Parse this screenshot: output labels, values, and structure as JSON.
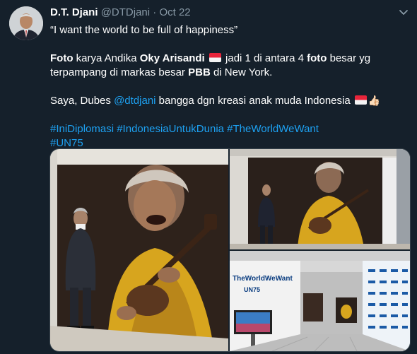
{
  "tweet": {
    "name": "D.T. Djani",
    "handle": "@DTDjani",
    "separator": "·",
    "date": "Oct 22",
    "line1": "“I want the world to be full of happiness”",
    "p2": {
      "foto1": "Foto",
      "t1": " karya Andika ",
      "oky": "Oky Arisandi",
      "t2": " jadi 1 di antara 4 ",
      "foto2": "foto",
      "t3": " besar yg terpampang di markas besar ",
      "pbb": "PBB",
      "t4": " di New York."
    },
    "p3": {
      "t1": "Saya, Dubes ",
      "mention": "@dtdjani",
      "t2": " bangga dgn kreasi anak muda Indonesia"
    },
    "hashtags": {
      "h1": "#IniDiplomasi",
      "h2": "#IndonesiaUntukDunia",
      "h3": "#TheWorldWeWant",
      "h4": "#UN75"
    }
  },
  "media": {
    "photo3_sign": "TheWorldWeWant",
    "photo3_un": "UN75"
  },
  "icons": {
    "caret": "chevron-down-icon",
    "flag": "indonesia-flag-emoji",
    "thumb": "thumbs-up-emoji"
  },
  "colors": {
    "background": "#15202b",
    "text": "#ffffff",
    "secondary": "#8899a6",
    "link": "#1da1f2",
    "border": "#38444d"
  }
}
